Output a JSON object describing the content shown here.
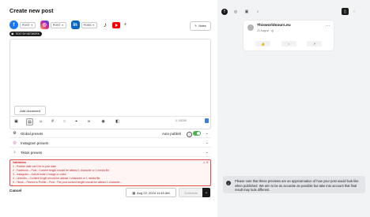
{
  "composer": {
    "title": "Create new post",
    "networks": [
      {
        "name": "facebook",
        "icon": "facebook-icon",
        "chip": "POST",
        "color": "#1877f2"
      },
      {
        "name": "instagram",
        "icon": "instagram-icon",
        "chip": "POST",
        "color": "#d6249f"
      },
      {
        "name": "linkedin",
        "icon": "linkedin-icon",
        "chip": "POSS",
        "color": "#0a66c2"
      },
      {
        "name": "tiktok",
        "icon": "tiktok-icon",
        "chip": "",
        "color": "#111111"
      },
      {
        "name": "youtube",
        "icon": "youtube-icon",
        "chip": "",
        "color": "#ff0000"
      }
    ],
    "add_network_label": "+",
    "notes_label": "Notes",
    "network_tag": "TEXT BY NETWORK",
    "add_document_label": "Add document",
    "counter": "0 / 63206",
    "global_presets_label": "Global presets",
    "instagram_presets_label": "Instagram presets",
    "tiktok_presets_label": "Tiktok presets",
    "auto_publish_label": "Auto publish",
    "auto_publish_on": true,
    "errors_title": "Validation",
    "errors_count": "5",
    "errors": [
      "1 - Publish date can't be in your date",
      "2 - Facebook – Post : Content length should be atleast 1 character or 1 media file",
      "3 - Instagram – Add at least 1 image or video.",
      "4 - LinkedIn – Content length should be atleast 1 character or 1 media file",
      "5 - Tiktok – Pinned to Profile – Post : The post content length should be atleast 1 character..."
    ],
    "cancel_label": "Cancel",
    "date_value": "Aug 22, 2024 11:45 AM",
    "schedule_label": "Schedule"
  },
  "preview": {
    "tabs": [
      "facebook-icon",
      "instagram-icon",
      "linkedin-icon",
      "tiktok-icon"
    ],
    "page_name": "Thisworldsours.eu",
    "post_date": "22 August ·",
    "disclaimer": "Please note that these previews are an approximation of how your post would look like when published. We aim to be as accurate as possible but take into account that final result may look different."
  },
  "colors": {
    "accent": "#4caf50",
    "error": "#c62828",
    "dark": "#1a1a1a"
  }
}
